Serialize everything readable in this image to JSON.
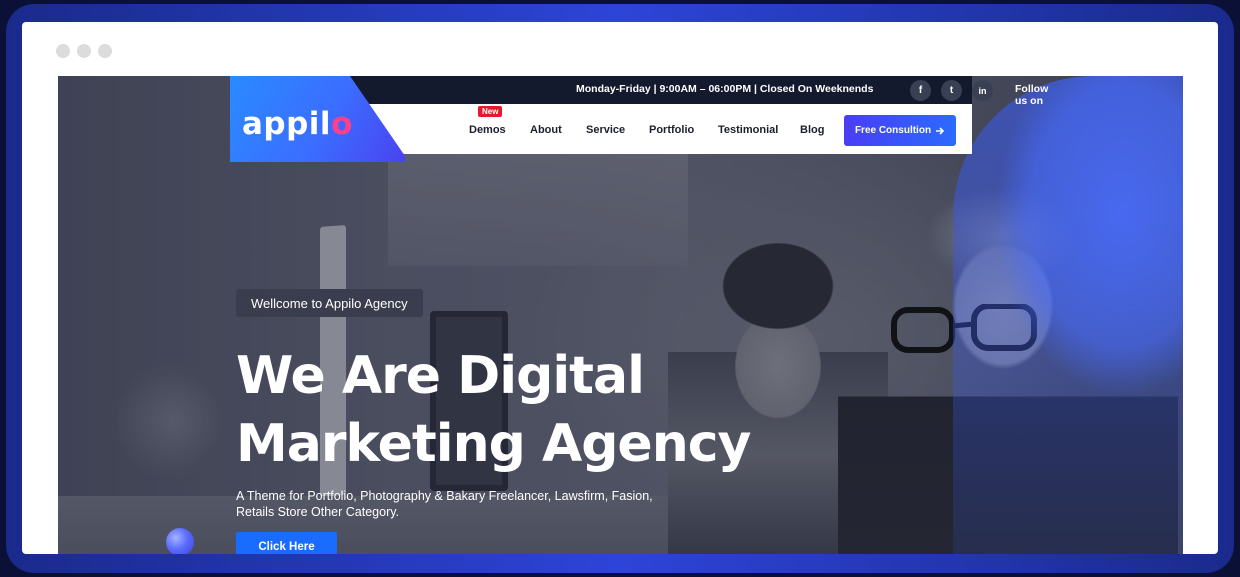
{
  "topbar": {
    "hours": "Monday-Friday | 9:00AM – 06:00PM | Closed On Weeknends",
    "follow_label": "Follow us on",
    "social": [
      {
        "icon": "facebook-icon",
        "glyph": "f"
      },
      {
        "icon": "twitter-icon",
        "glyph": "t"
      },
      {
        "icon": "linkedin-icon",
        "glyph": "in"
      }
    ]
  },
  "logo": {
    "text_main": "appil",
    "text_accent": "o"
  },
  "nav": {
    "badge": "New",
    "items": [
      "Demos",
      "About",
      "Service",
      "Portfolio",
      "Testimonial",
      "Blog"
    ],
    "cta_label": "Free Consultion",
    "cta_icon": "arrow-right-icon"
  },
  "hero": {
    "welcome": "Wellcome to Appilo Agency",
    "title_line1": "We Are Digital",
    "title_line2": "Marketing Agency",
    "subtitle": "A Theme for Portfolio, Photography & Bakary Freelancer, Lawsfirm, Fasion, Retails Store Other Category.",
    "button_label": "Click Here"
  },
  "colors": {
    "accent": "#2a6bff",
    "badge": "#e4192b",
    "logo_accent": "#ff3f8b",
    "topbar": "#141a2e"
  }
}
